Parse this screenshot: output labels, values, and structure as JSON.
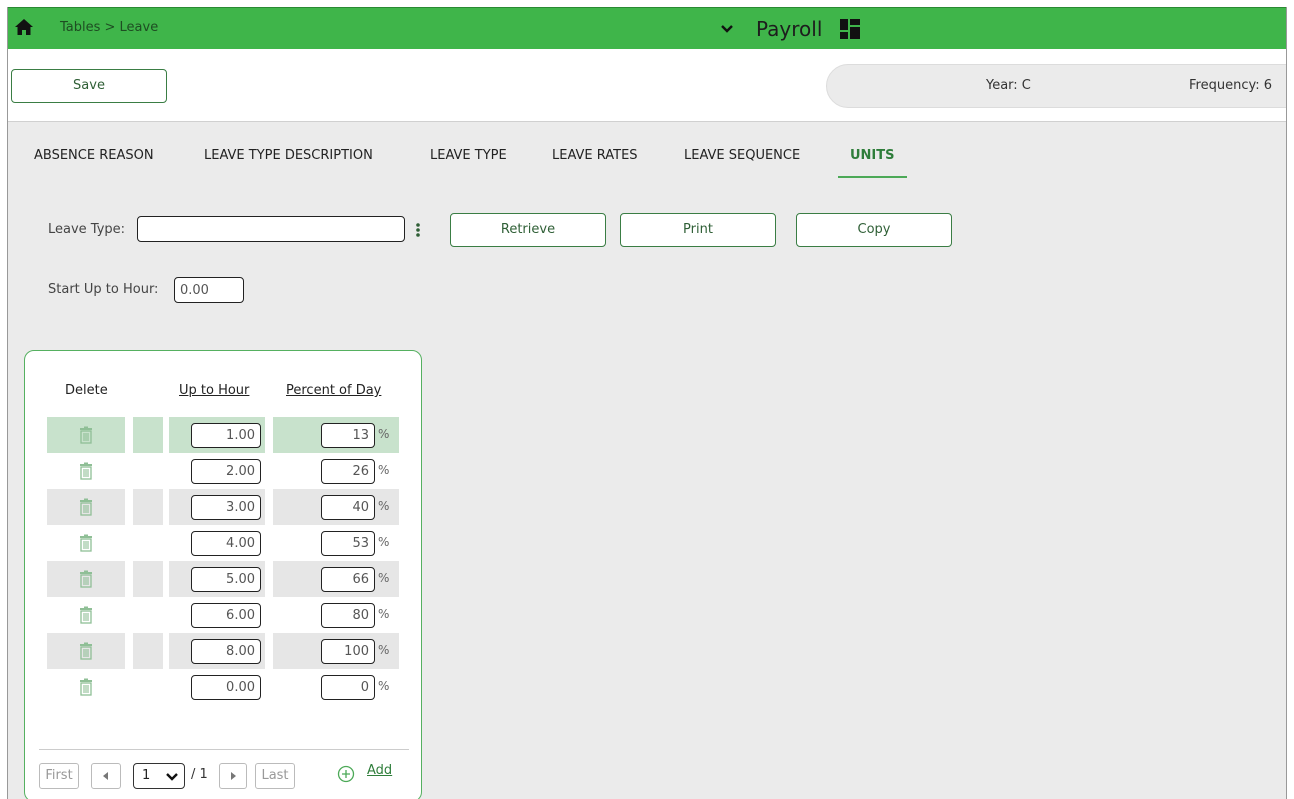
{
  "header": {
    "breadcrumb": "Tables > Leave",
    "module": "Payroll"
  },
  "toolbar": {
    "save_label": "Save",
    "year": "Year: C",
    "frequency": "Frequency: 6"
  },
  "tabs": [
    {
      "label": "ABSENCE REASON"
    },
    {
      "label": "LEAVE TYPE DESCRIPTION"
    },
    {
      "label": "LEAVE TYPE"
    },
    {
      "label": "LEAVE RATES"
    },
    {
      "label": "LEAVE SEQUENCE"
    },
    {
      "label": "UNITS",
      "active": true
    }
  ],
  "form": {
    "leave_type_label": "Leave Type:",
    "leave_type_value": "",
    "start_label": "Start Up to Hour:",
    "start_value": "0.00",
    "retrieve_label": "Retrieve",
    "print_label": "Print",
    "copy_label": "Copy"
  },
  "grid": {
    "headers": {
      "delete": "Delete",
      "up_to_hour": "Up to Hour",
      "percent_of_day": "Percent of Day"
    },
    "percent_sign": "%",
    "rows": [
      {
        "up_to_hour": "1.00",
        "percent": "13"
      },
      {
        "up_to_hour": "2.00",
        "percent": "26"
      },
      {
        "up_to_hour": "3.00",
        "percent": "40"
      },
      {
        "up_to_hour": "4.00",
        "percent": "53"
      },
      {
        "up_to_hour": "5.00",
        "percent": "66"
      },
      {
        "up_to_hour": "6.00",
        "percent": "80"
      },
      {
        "up_to_hour": "8.00",
        "percent": "100"
      },
      {
        "up_to_hour": "0.00",
        "percent": "0"
      }
    ],
    "selected_row": 0
  },
  "pagination": {
    "first": "First",
    "last": "Last",
    "page": "1",
    "total": "/ 1",
    "add": "Add"
  },
  "icons": {
    "home": "home-icon",
    "chevron": "chevron-down-icon",
    "grid": "grid-icon",
    "kebab": "kebab-icon",
    "trash": "trash-icon",
    "add": "add-icon"
  },
  "colors": {
    "brand_green": "#3fb54a",
    "selected_row": "#c8e2cc",
    "alt_row": "#e6e6e6"
  }
}
